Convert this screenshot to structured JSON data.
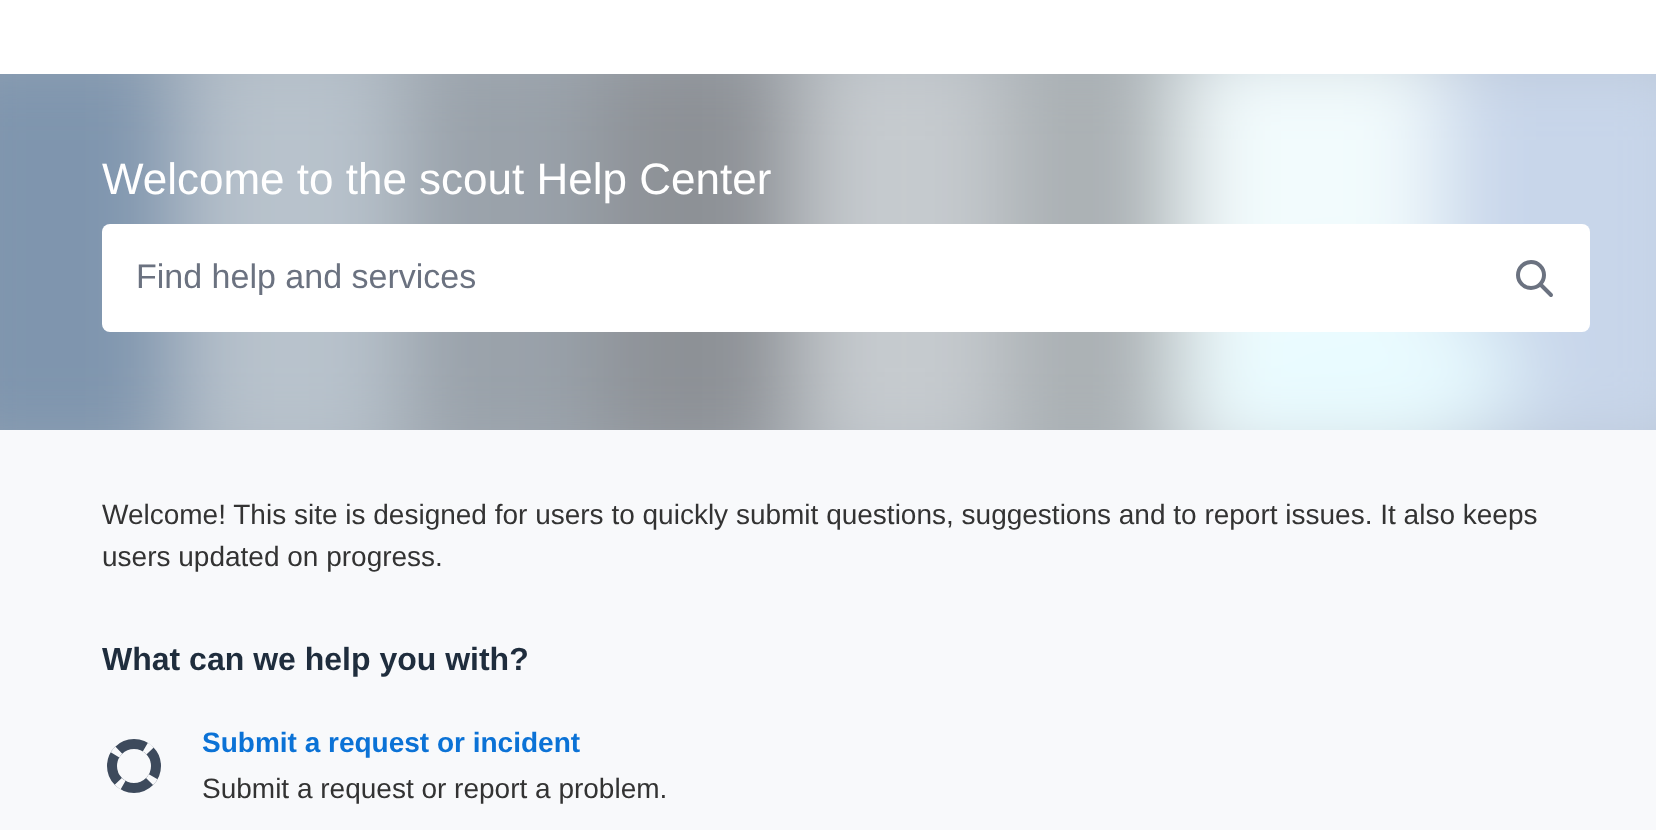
{
  "banner": {
    "title": "Welcome to the scout Help Center",
    "search": {
      "placeholder": "Find help and services"
    }
  },
  "intro": "Welcome! This site is designed for users to quickly submit questions, suggestions and to report issues. It also keeps users updated on progress.",
  "section": {
    "heading": "What can we help you with?",
    "items": [
      {
        "title": "Submit a request or incident",
        "description": "Submit a request or report a problem."
      }
    ]
  }
}
